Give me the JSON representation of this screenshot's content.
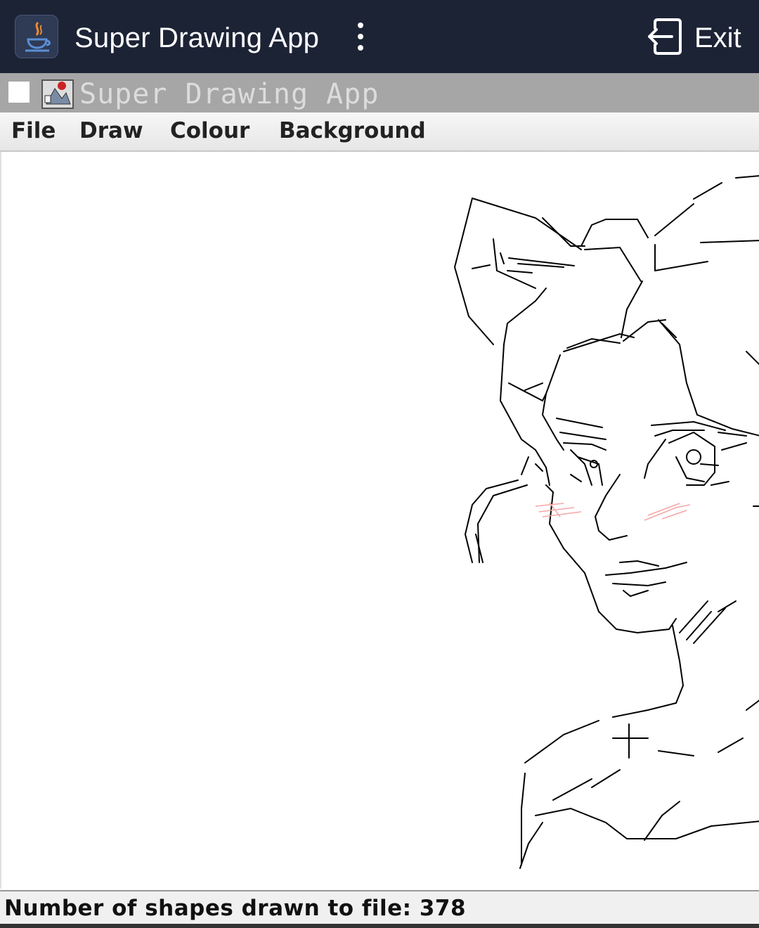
{
  "host": {
    "title": "Super Drawing App",
    "app_icon": "java-cup-icon",
    "menu_icon": "kebab-menu-icon",
    "exit_icon": "exit-door-icon",
    "exit_label": "Exit",
    "bar_color": "#1c2335"
  },
  "frame": {
    "title": "Super Drawing App",
    "titlebar_color": "#a6a6a6"
  },
  "menubar": {
    "items": [
      "File",
      "Draw",
      "Colour",
      "Background"
    ]
  },
  "canvas": {
    "background": "#ffffff",
    "stroke_color": "#000000",
    "blush_color": "#f4a6a6"
  },
  "status": {
    "text": "Number of shapes drawn to file: 378"
  }
}
